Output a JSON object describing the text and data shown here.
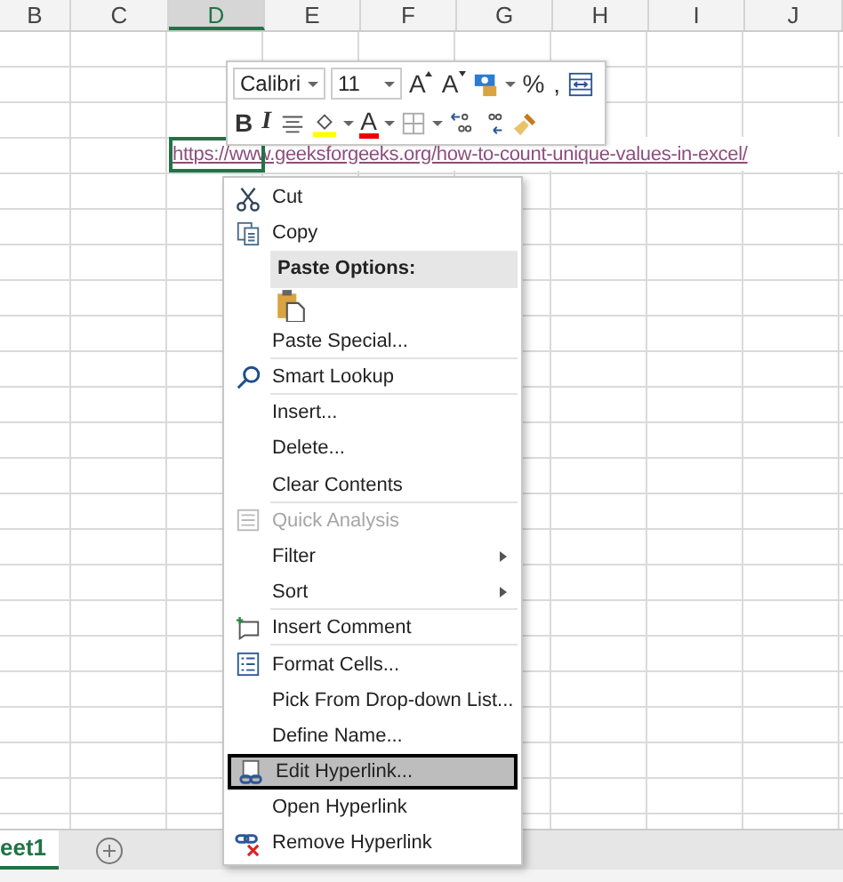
{
  "columns": [
    {
      "label": "B",
      "selected": false
    },
    {
      "label": "C",
      "selected": false
    },
    {
      "label": "D",
      "selected": true
    },
    {
      "label": "E",
      "selected": false
    },
    {
      "label": "F",
      "selected": false
    },
    {
      "label": "G",
      "selected": false
    },
    {
      "label": "H",
      "selected": false
    },
    {
      "label": "I",
      "selected": false
    },
    {
      "label": "J",
      "selected": false
    }
  ],
  "link_cell": {
    "text": "https://www.geeksforgeeks.org/how-to-count-unique-values-in-excel/",
    "selected": true
  },
  "mini_toolbar": {
    "font": "Calibri",
    "size": "11",
    "row1": [
      {
        "kind": "grow",
        "label": "A",
        "dropdown": false
      },
      {
        "kind": "shrink",
        "label": "A",
        "dropdown": false
      },
      {
        "kind": "accounting",
        "dropdown": true
      },
      {
        "kind": "percent",
        "label": "%",
        "dropdown": false
      },
      {
        "kind": "comma",
        "label": ",",
        "dropdown": false
      },
      {
        "kind": "wrap",
        "dropdown": false
      }
    ],
    "row2": [
      {
        "kind": "bold",
        "label": "B",
        "dropdown": false
      },
      {
        "kind": "italic",
        "label": "I",
        "dropdown": false
      },
      {
        "kind": "align",
        "dropdown": false
      },
      {
        "kind": "fill",
        "dropdown": true
      },
      {
        "kind": "font-color",
        "label": "A",
        "dropdown": true
      },
      {
        "kind": "borders",
        "dropdown": true
      },
      {
        "kind": "inc-decimal",
        "dropdown": false
      },
      {
        "kind": "dec-decimal",
        "dropdown": false
      },
      {
        "kind": "painter",
        "dropdown": false
      }
    ]
  },
  "context_menu": [
    {
      "kind": "cut",
      "label": "Cut",
      "disabled": false,
      "selected": false,
      "submenu": false,
      "separator_after": false
    },
    {
      "kind": "copy",
      "label": "Copy",
      "disabled": false,
      "selected": false,
      "submenu": false,
      "separator_after": false
    },
    {
      "kind": "header",
      "label": "Paste Options:",
      "disabled": false,
      "selected": false,
      "submenu": false,
      "separator_after": false
    },
    {
      "kind": "paste",
      "disabled": false,
      "selected": false,
      "submenu": false,
      "separator_after": false
    },
    {
      "kind": "plain",
      "label": "Paste Special...",
      "disabled": false,
      "selected": false,
      "submenu": false,
      "separator_after": true
    },
    {
      "kind": "lookup",
      "label": "Smart Lookup",
      "disabled": false,
      "selected": false,
      "submenu": false,
      "separator_after": true
    },
    {
      "kind": "plain",
      "label": "Insert...",
      "disabled": false,
      "selected": false,
      "submenu": false,
      "separator_after": false
    },
    {
      "kind": "plain",
      "label": "Delete...",
      "disabled": false,
      "selected": false,
      "submenu": false,
      "separator_after": false
    },
    {
      "kind": "plain",
      "label": "Clear Contents",
      "disabled": false,
      "selected": false,
      "submenu": false,
      "separator_after": true
    },
    {
      "kind": "quick",
      "label": "Quick Analysis",
      "disabled": true,
      "selected": false,
      "submenu": false,
      "separator_after": false
    },
    {
      "kind": "plain",
      "label": "Filter",
      "disabled": false,
      "selected": false,
      "submenu": true,
      "separator_after": false
    },
    {
      "kind": "plain",
      "label": "Sort",
      "disabled": false,
      "selected": false,
      "submenu": true,
      "separator_after": true
    },
    {
      "kind": "comment",
      "label": "Insert Comment",
      "disabled": false,
      "selected": false,
      "submenu": false,
      "separator_after": true
    },
    {
      "kind": "format",
      "label": "Format Cells...",
      "disabled": false,
      "selected": false,
      "submenu": false,
      "separator_after": false
    },
    {
      "kind": "plain",
      "label": "Pick From Drop-down List...",
      "disabled": false,
      "selected": false,
      "submenu": false,
      "separator_after": false
    },
    {
      "kind": "plain",
      "label": "Define Name...",
      "disabled": false,
      "selected": false,
      "submenu": false,
      "separator_after": false
    },
    {
      "kind": "link-edit",
      "label": "Edit Hyperlink...",
      "disabled": false,
      "selected": true,
      "submenu": false,
      "separator_after": false
    },
    {
      "kind": "plain",
      "label": "Open Hyperlink",
      "disabled": false,
      "selected": false,
      "submenu": false,
      "separator_after": false
    },
    {
      "kind": "link-remove",
      "label": "Remove Hyperlink",
      "disabled": false,
      "selected": false,
      "submenu": false,
      "separator_after": false
    }
  ],
  "sheet_tab": {
    "label": "eet1",
    "selected": true
  }
}
